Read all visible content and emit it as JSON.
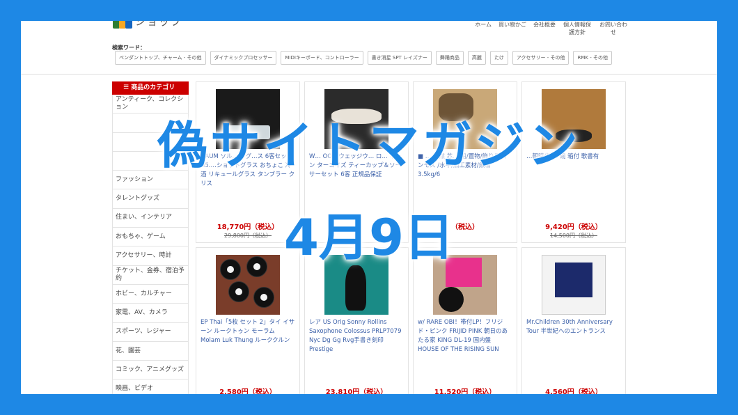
{
  "header": {
    "logo_text": "ショップ",
    "nav": [
      "ホーム",
      "買い物かご",
      "会社概要",
      "個人情報保護方針",
      "お問い合わせ"
    ]
  },
  "search": {
    "label": "検索ワード：",
    "keywords": [
      "ペンダントトップ、チャーム - その他",
      "ダイナミックプロセッサー",
      "MIDIキーボード、コントローラー",
      "書き消星 SPT レイズナー",
      "舞踊商品",
      "高麗",
      "たけ",
      "アクセサリー - その他",
      "RMK - その他"
    ]
  },
  "sidebar": {
    "heading": "商品のカテゴリ",
    "items": [
      "アンティーク、コレクション",
      "",
      "",
      "",
      "ファッション",
      "タレントグッズ",
      "住まい、インテリア",
      "おもちゃ、ゲーム",
      "アクセサリー、時計",
      "チケット、金券、宿泊予約",
      "ホビー、カルチャー",
      "家電、AV、カメラ",
      "スポーツ、レジャー",
      "花、園芸",
      "コミック、アニメグッズ",
      "映画、ビデオ"
    ]
  },
  "products": [
    {
      "title": "DAUM ソル… Y グ…ス 6客セット H5.…ショットグラス おちょこ 冷酒 リキュールグラス タンブラー クリス",
      "price": "18,770円（税込）",
      "old_price": "29,800円（税込）"
    },
    {
      "title": "W… OOD ウェッジウ… ロ… ィーン ターコイズ ティーカップ＆ソーサーセット 6客 正規品保証",
      "price": "",
      "old_price": ""
    },
    {
      "title": "■ … 自然 芯… 用/置物/飾り用/マンモス /水牛/加工素材/無垢3.5kg/6",
      "price": "（税込）",
      "old_price": ""
    },
    {
      "title": "…朝時代 … 碗 箱付 歌書有",
      "price": "9,420円（税込）",
      "old_price": "14,500円（税込）"
    },
    {
      "title": "EP Thai「5枚 セット 2」タイ イサーン ルークトゥン モーラム Molam Luk Thung ルーククルン",
      "price": "2,580円（税込）",
      "old_price": ""
    },
    {
      "title": "レア US Orig Sonny Rollins Saxophone Colossus PRLP7079 Nyc Dg Gg Rvg手書き刻印 Prestige",
      "price": "23,810円（税込）",
      "old_price": ""
    },
    {
      "title": "w/ RARE OBI！帯付LP！フリジド・ピンク FRIJID PINK 朝日のあたる家 KING DL-19 国内盤 HOUSE OF THE RISING SUN",
      "price": "11,520円（税込）",
      "old_price": ""
    },
    {
      "title": "Mr.Children 30th Anniversary Tour 半世紀へのエントランス",
      "price": "4,560円（税込）",
      "old_price": ""
    }
  ],
  "overlay": {
    "title": "偽サイトマガジン",
    "date": "4月9日"
  },
  "colors": {
    "accent": "#1e88e5",
    "category_red": "#cc0000"
  }
}
